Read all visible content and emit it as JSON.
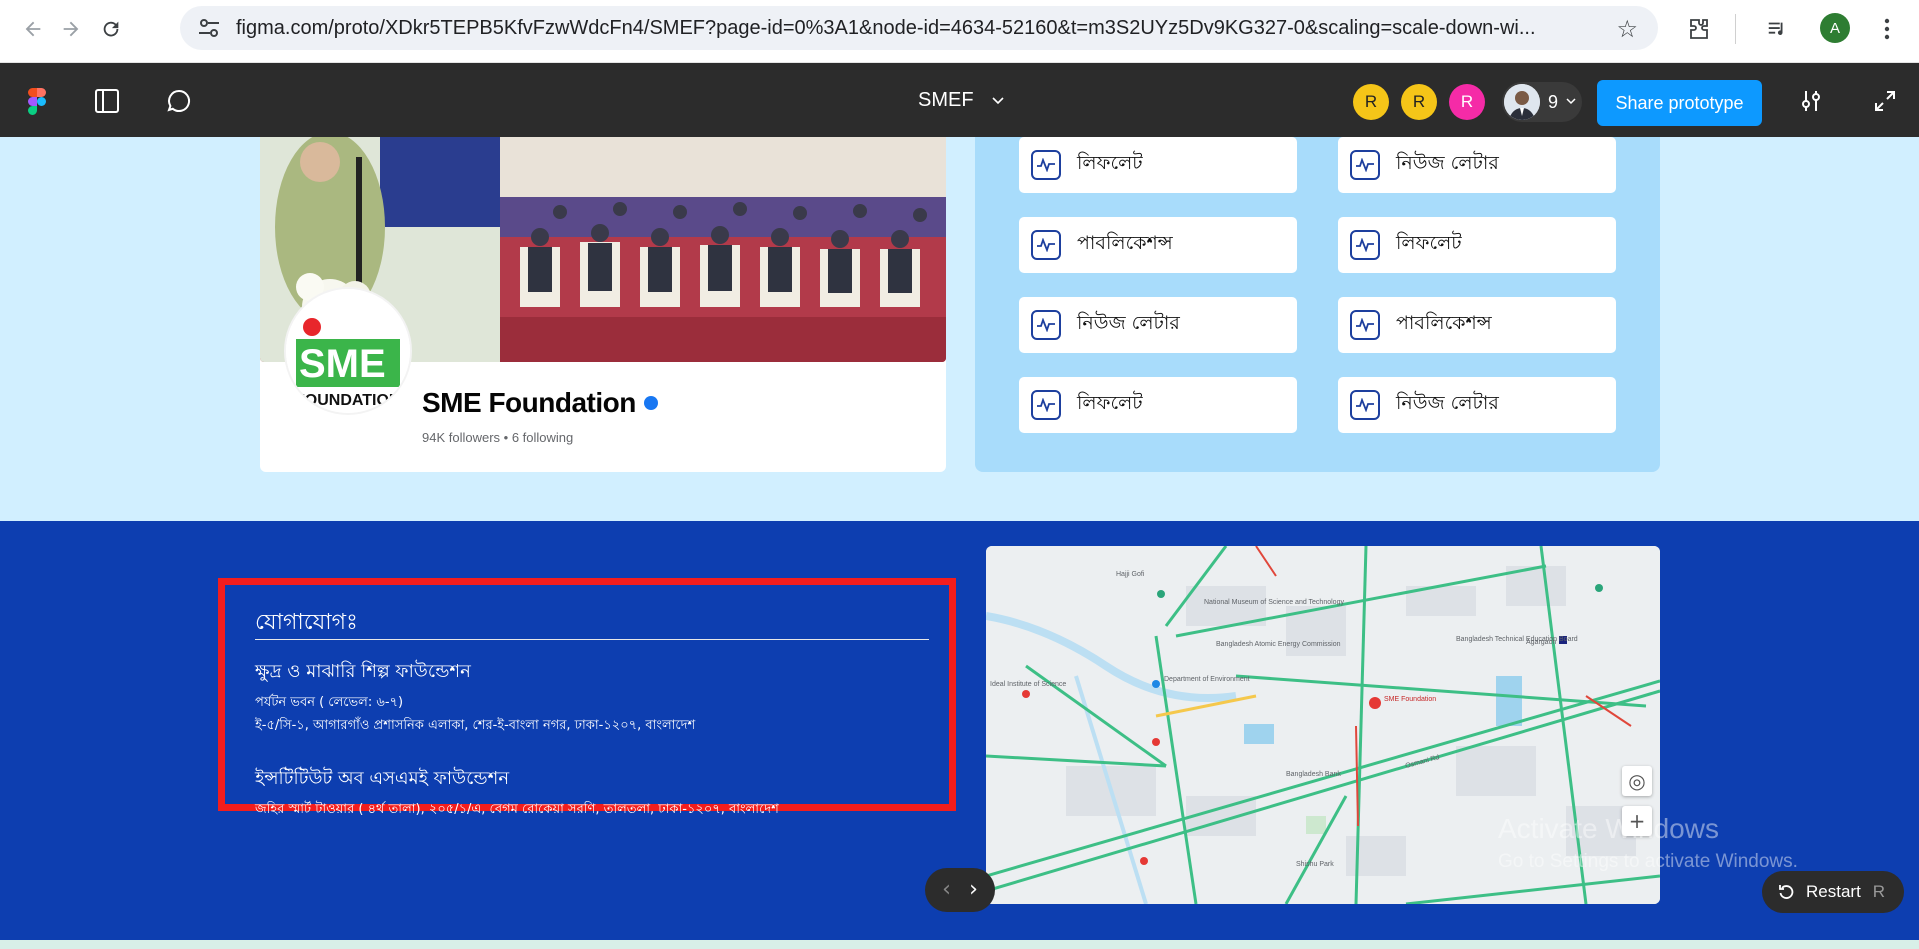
{
  "browser": {
    "url": "figma.com/proto/XDkr5TEPB5KfvFzwWdcFn4/SMEF?page-id=0%3A1&node-id=4634-52160&t=m3S2UYz5Dv9KG327-0&scaling=scale-down-wi...",
    "profile_initial": "A"
  },
  "figma": {
    "file_title": "SMEF",
    "collaborators": [
      "R",
      "R",
      "R"
    ],
    "collaborator_colors": [
      "#f5c518",
      "#f5c518",
      "#f52ba7"
    ],
    "viewer_count": "9",
    "share_label": "Share prototype"
  },
  "fb_card": {
    "page_name": "SME Foundation",
    "page_stats": "94K followers • 6 following",
    "logo_text_top": "SME",
    "logo_text_bottom": "FOUNDATION"
  },
  "resources": [
    "লিফলেট",
    "নিউজ লেটার",
    "পাবলিকেশন্স",
    "লিফলেট",
    "নিউজ লেটার",
    "পাবলিকেশন্স",
    "লিফলেট",
    "নিউজ লেটার"
  ],
  "contact": {
    "heading": "যোগাযোগঃ",
    "org1": "ক্ষুদ্র ও মাঝারি শিল্প ফাউন্ডেশন",
    "org1_line1": "পর্যটন ভবন ( লেভেল: ৬-৭)",
    "org1_line2": "ই-৫/সি-১, আগারগাঁও প্রশাসনিক এলাকা, শের-ই-বাংলা নগর, ঢাকা-১২০৭, বাংলাদেশ",
    "org2": "ইন্সটিটিউট অব এসএমই ফাউন্ডেশন",
    "org2_line1": "জহির স্মার্ট টাওয়ার ( ৪র্থ তালা), ২০৫/১/এ, বেগম রোকেয়া সরণি, তালতলা, ঢাকা-১২০৭, বাংলাদেশ"
  },
  "map": {
    "labels": [
      "Hajji Gofi",
      "National Museum of Science and Technology",
      "Bangladesh Atomic Energy Commission",
      "Department of Environment",
      "SME Foundation",
      "Bangladesh Technical Education Board",
      "Agargaon",
      "Osmani Rd",
      "Bangladesh Bank",
      "Shishu Park",
      "Ideal Institute of Science"
    ]
  },
  "overlay": {
    "activate_title": "Activate Windows",
    "activate_sub": "Go to Settings to activate Windows.",
    "restart_label": "Restart",
    "restart_key": "R"
  }
}
